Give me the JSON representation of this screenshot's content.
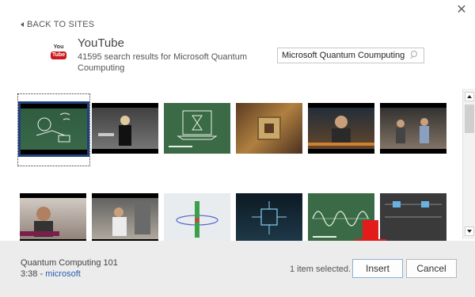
{
  "dialog": {
    "close_glyph": "✕"
  },
  "back_link": {
    "label": "BACK TO SITES",
    "icon": "chevron-left-icon"
  },
  "site": {
    "logo_top": "You",
    "logo_bottom": "Tube",
    "name": "YouTube",
    "results": "41595 search results for Microsoft Quantum Coumputing"
  },
  "search": {
    "value": "Microsoft Quantum Coumputing",
    "icon": "search-icon"
  },
  "thumbnails": [
    {
      "row": 1,
      "scene": "chalk-drawing",
      "selected": true
    },
    {
      "row": 1,
      "scene": "lecturer"
    },
    {
      "row": 1,
      "scene": "hourglass-laptop"
    },
    {
      "row": 1,
      "scene": "quantum-chip"
    },
    {
      "row": 1,
      "scene": "news-presenter"
    },
    {
      "row": 1,
      "scene": "office-people"
    },
    {
      "row": 2,
      "scene": "speaker-portrait"
    },
    {
      "row": 2,
      "scene": "lab-worker"
    },
    {
      "row": 2,
      "scene": "qubit-diagram"
    },
    {
      "row": 2,
      "scene": "circuit-board"
    },
    {
      "row": 2,
      "scene": "wave-chalkboard"
    },
    {
      "row": 2,
      "scene": "circuit-schematic"
    }
  ],
  "footer": {
    "video_title": "Quantum Computing 101",
    "duration": "3:38",
    "separator": " - ",
    "channel": "microsoft",
    "status": "1 item selected.",
    "insert_label": "Insert",
    "cancel_label": "Cancel"
  },
  "colors": {
    "selection_frame": "#1f3f7f",
    "annotation_arrow": "#e21b1b",
    "youtube_red": "#cc181e"
  }
}
